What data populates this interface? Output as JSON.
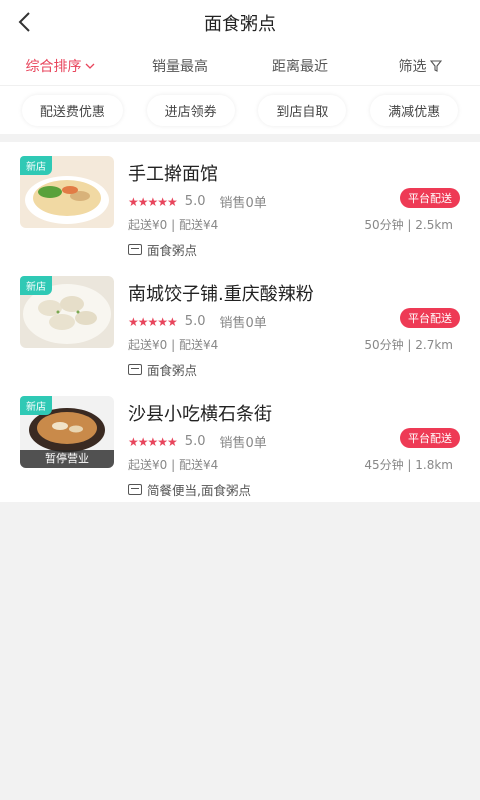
{
  "header": {
    "title": "面食粥点",
    "back_icon": "chevron-left-icon"
  },
  "sort_tabs": [
    {
      "label": "综合排序",
      "active": true,
      "icon": "chevron-down-icon"
    },
    {
      "label": "销量最高",
      "active": false
    },
    {
      "label": "距离最近",
      "active": false
    },
    {
      "label": "筛选",
      "active": false,
      "icon": "filter-icon"
    }
  ],
  "chips": [
    "配送费优惠",
    "进店领券",
    "到店自取",
    "满减优惠"
  ],
  "colors": {
    "accent": "#e8455c",
    "new_badge": "#2fc9b5",
    "delivery_pill": "#ee3a55"
  },
  "stores": [
    {
      "name": "手工擀面馆",
      "badge": "新店",
      "stars": "★★★★★",
      "score": "5.0",
      "sales": "销售0单",
      "delivery_tag": "平台配送",
      "fee": "起送¥0 | 配送¥4",
      "eta": "50分钟 | 2.5km",
      "category": "面食粥点",
      "paused": ""
    },
    {
      "name": "南城饺子铺.重庆酸辣粉",
      "badge": "新店",
      "stars": "★★★★★",
      "score": "5.0",
      "sales": "销售0单",
      "delivery_tag": "平台配送",
      "fee": "起送¥0 | 配送¥4",
      "eta": "50分钟 | 2.7km",
      "category": "面食粥点",
      "paused": ""
    },
    {
      "name": "沙县小吃横石条街",
      "badge": "新店",
      "stars": "★★★★★",
      "score": "5.0",
      "sales": "销售0单",
      "delivery_tag": "平台配送",
      "fee": "起送¥0 | 配送¥4",
      "eta": "45分钟 | 1.8km",
      "category": "简餐便当,面食粥点",
      "paused": "暂停营业"
    }
  ]
}
